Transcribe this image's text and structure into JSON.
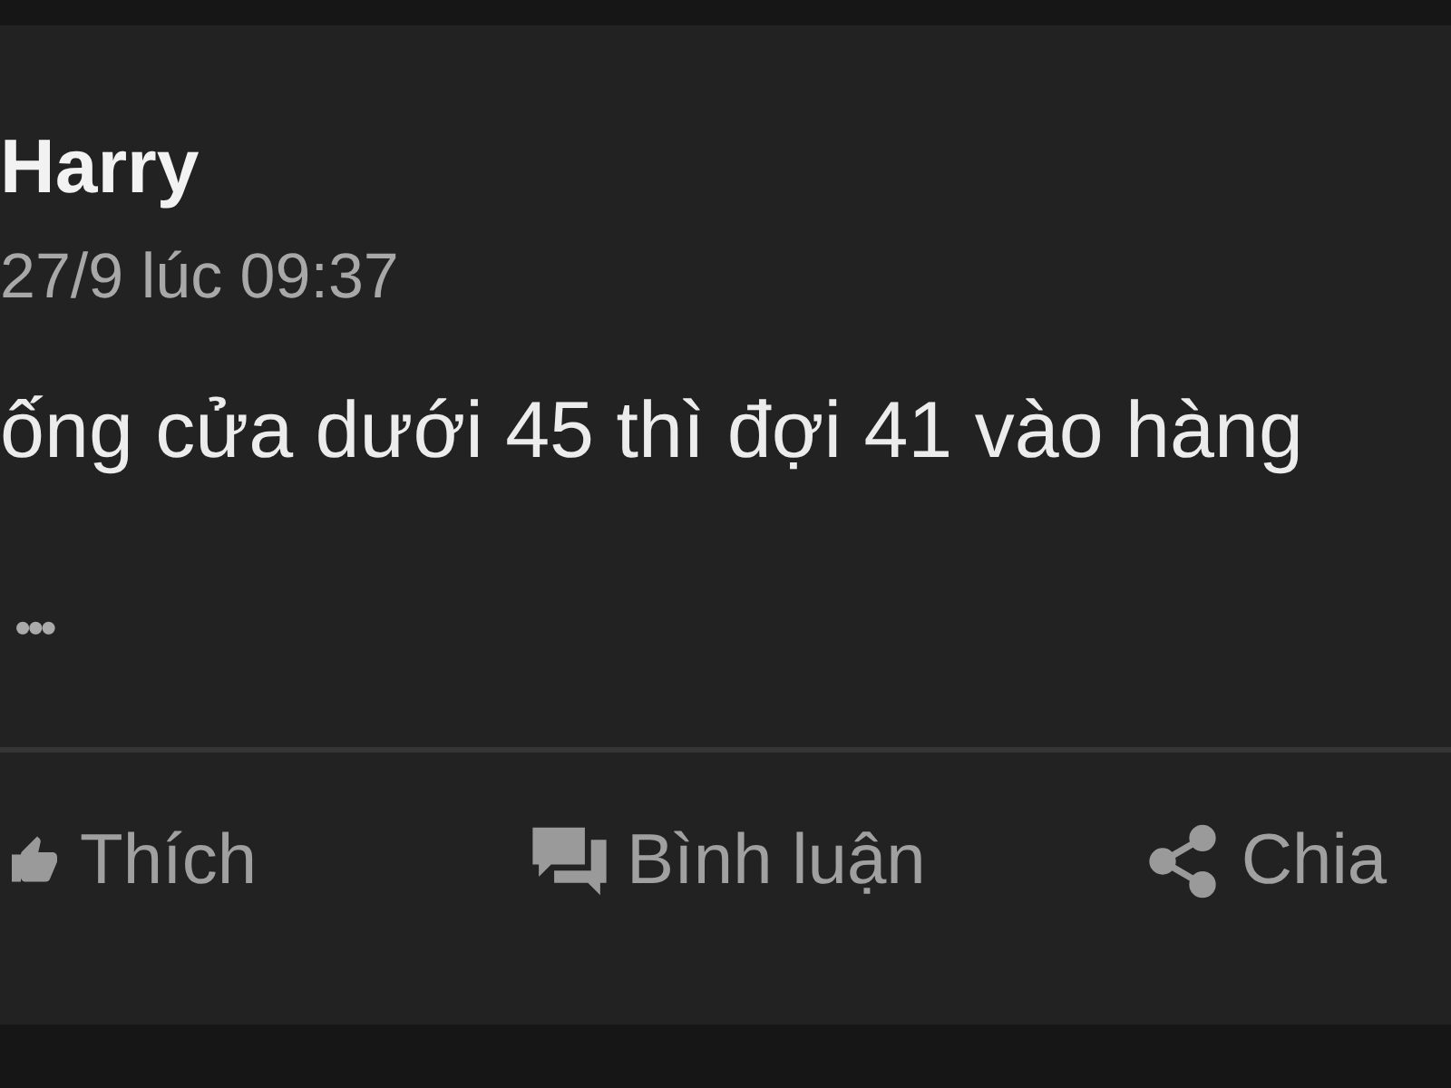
{
  "post": {
    "author": "Harry",
    "time": "27/9 lúc 09:37",
    "text": "ống cửa dưới 45 thì đợi 41 vào hàng",
    "more": "•••"
  },
  "actions": [
    {
      "kind": "like",
      "label": "Thích"
    },
    {
      "kind": "comment",
      "label": "Bình luận"
    },
    {
      "kind": "share",
      "label": "Chia"
    }
  ]
}
